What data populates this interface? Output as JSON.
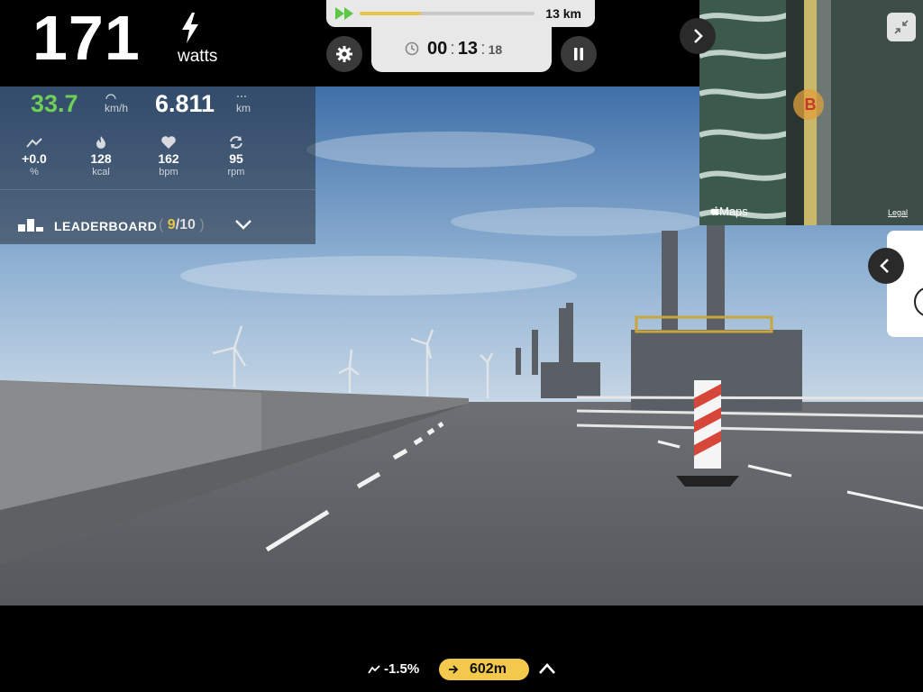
{
  "power": {
    "value": "171",
    "unit": "watts",
    "icon": "lightning-bolt-icon"
  },
  "route": {
    "progress_fraction": 0.35,
    "total_distance": "13 km"
  },
  "timer": {
    "hours": "00",
    "minutes": "13",
    "seconds": "18"
  },
  "stats": {
    "speed": {
      "value": "33.7",
      "unit": "km/h"
    },
    "distance": {
      "value": "6.811",
      "unit": "km"
    },
    "grade": {
      "value": "+0.0",
      "label": "%"
    },
    "calories": {
      "value": "128",
      "label": "kcal"
    },
    "heart_rate": {
      "value": "162",
      "label": "bpm"
    },
    "cadence": {
      "value": "95",
      "label": "rpm"
    }
  },
  "leaderboard": {
    "label": "LEADERBOARD",
    "rank": "9",
    "total": "10"
  },
  "map": {
    "provider": "Maps",
    "legal": "Legal",
    "marker": "B"
  },
  "bottom": {
    "upcoming_grade": "-1.5%",
    "turn_distance": "602m"
  },
  "colors": {
    "speed_green": "#6fcf57",
    "accent_yellow": "#f2c94c",
    "panel_gray": "#e8e8e8"
  }
}
